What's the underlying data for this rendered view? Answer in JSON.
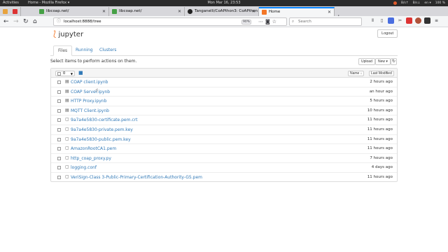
{
  "os_bar": {
    "activities": "Activities",
    "app_title": "Home - Mozilla Firefox ▾",
    "clock": "Mon Mar 16, 23:53",
    "tray": [
      "B/s↑",
      "B/s↓",
      "en ▾",
      "100 %"
    ]
  },
  "browser": {
    "tabs": [
      {
        "label": "",
        "favicon_color": "#e8a33d"
      },
      {
        "label": "libcoap.net/",
        "favicon_color": "#45a045"
      },
      {
        "label": "libcoap.net/",
        "favicon_color": "#45a045"
      },
      {
        "label": "Tanganelli/CoAPthon3: CoAPthon",
        "favicon_color": "#222222"
      },
      {
        "label": "Home",
        "favicon_color": "#f37626"
      }
    ],
    "new_tab": "+",
    "url": "localhost:8888/tree",
    "zoom": "90%",
    "search_placeholder": "Search"
  },
  "jupyter": {
    "logo_text": "jupyter",
    "logout_label": "Logout",
    "tabs": [
      "Files",
      "Running",
      "Clusters"
    ],
    "select_message": "Select items to perform actions on them.",
    "upload_label": "Upload",
    "new_label": "New ▾",
    "selected_count": "0",
    "sort_name_label": "Name ↓",
    "sort_modified_label": "Last Modified",
    "files": [
      {
        "name": "COAP client.ipynb",
        "type": "notebook",
        "modified": "2 hours ago"
      },
      {
        "name": "COAP Server.ipynb",
        "type": "notebook",
        "modified": "an hour ago"
      },
      {
        "name": "HTTP Proxy.ipynb",
        "type": "notebook",
        "modified": "5 hours ago"
      },
      {
        "name": "MQTT Client.ipynb",
        "type": "notebook",
        "modified": "10 hours ago"
      },
      {
        "name": "9a7a4e5830-certificate.pem.crt",
        "type": "file",
        "modified": "11 hours ago"
      },
      {
        "name": "9a7a4e5830-private.pem.key",
        "type": "file",
        "modified": "11 hours ago"
      },
      {
        "name": "9a7a4e5830-public.pem.key",
        "type": "file",
        "modified": "11 hours ago"
      },
      {
        "name": "AmazonRootCA1.pem",
        "type": "file",
        "modified": "11 hours ago"
      },
      {
        "name": "http_coap_proxy.py",
        "type": "file",
        "modified": "7 hours ago"
      },
      {
        "name": "logging.conf",
        "type": "file",
        "modified": "4 days ago"
      },
      {
        "name": "VeriSign-Class 3-Public-Primary-Certification-Authority-G5.pem",
        "type": "file",
        "modified": "11 hours ago"
      }
    ]
  }
}
